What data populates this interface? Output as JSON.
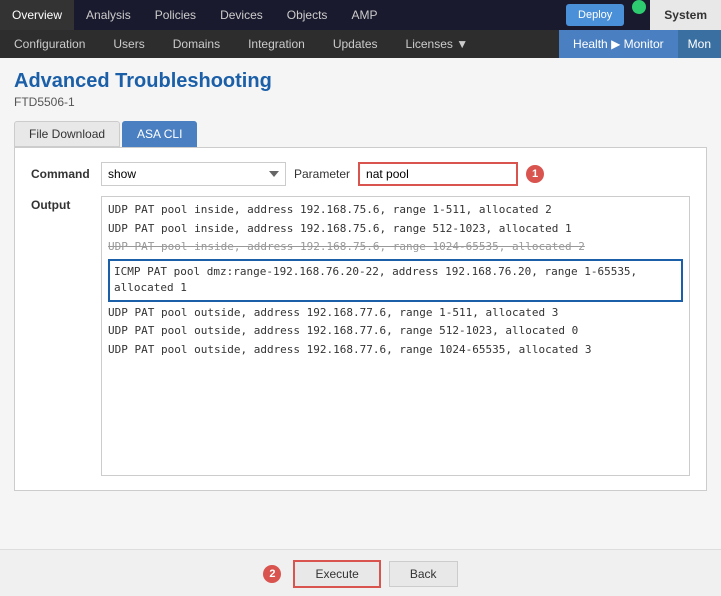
{
  "topnav": {
    "items": [
      {
        "label": "Overview",
        "active": false
      },
      {
        "label": "Analysis",
        "active": false
      },
      {
        "label": "Policies",
        "active": false
      },
      {
        "label": "Devices",
        "active": false
      },
      {
        "label": "Objects",
        "active": false
      },
      {
        "label": "AMP",
        "active": false
      }
    ],
    "deploy_label": "Deploy",
    "system_label": "System"
  },
  "secondnav": {
    "items": [
      {
        "label": "Configuration"
      },
      {
        "label": "Users"
      },
      {
        "label": "Domains"
      },
      {
        "label": "Integration"
      },
      {
        "label": "Updates"
      },
      {
        "label": "Licenses ▼"
      }
    ],
    "health_monitor_label": "Health ▶ Monitor",
    "mon_label": "Mon"
  },
  "page": {
    "title": "Advanced Troubleshooting",
    "subtitle": "FTD5506-1"
  },
  "tabs": [
    {
      "label": "File Download",
      "active": false
    },
    {
      "label": "ASA CLI",
      "active": true
    }
  ],
  "form": {
    "command_label": "Command",
    "command_value": "show",
    "param_label": "Parameter",
    "param_value": "nat pool",
    "badge_1": "1",
    "output_label": "Output",
    "output_lines": [
      {
        "text": "UDP PAT pool inside, address 192.168.75.6, range 1-511, allocated 2",
        "style": "normal"
      },
      {
        "text": "UDP PAT pool inside, address 192.168.75.6, range 512-1023, allocated 1",
        "style": "normal"
      },
      {
        "text": "UDP PAT pool inside, address 192.168.75.6, range 1024-65535, allocated 2",
        "style": "strikethrough"
      },
      {
        "text": "ICMP PAT pool dmz:range-192.168.76.20-22, address 192.168.76.20, range 1-65535, allocated 1",
        "style": "highlighted"
      },
      {
        "text": "UDP PAT pool outside, address 192.168.77.6, range 1-511, allocated 3",
        "style": "normal"
      },
      {
        "text": "UDP PAT pool outside, address 192.168.77.6, range 512-1023, allocated 0",
        "style": "normal"
      },
      {
        "text": "UDP PAT pool outside, address 192.168.77.6, range 1024-65535, allocated 3",
        "style": "normal"
      }
    ]
  },
  "footer": {
    "badge_2": "2",
    "execute_label": "Execute",
    "back_label": "Back"
  }
}
